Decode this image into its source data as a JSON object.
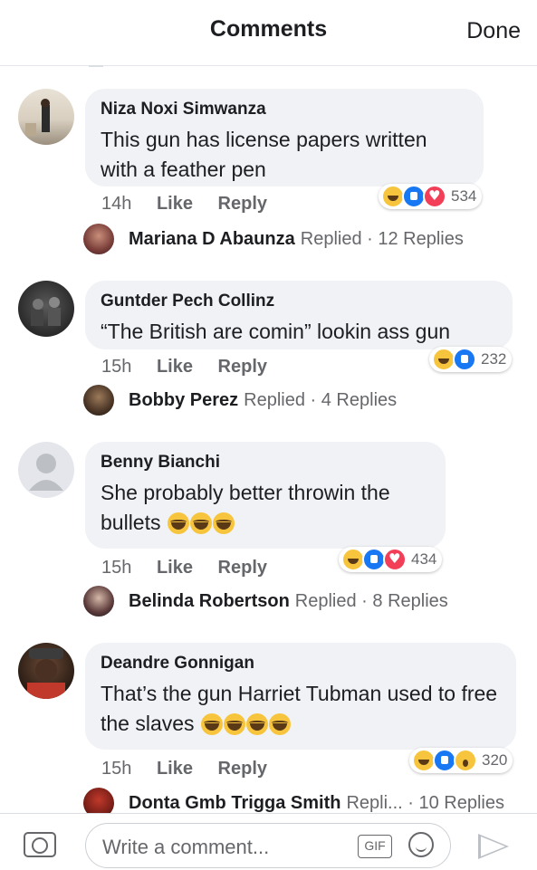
{
  "header": {
    "title": "Comments",
    "done_label": "Done"
  },
  "comments": [
    {
      "author": "Niza Noxi Simwanza",
      "text": "This gun has license papers written with a feather pen",
      "time": "14h",
      "like_label": "Like",
      "reply_label": "Reply",
      "reactions": [
        "haha",
        "like",
        "love"
      ],
      "reaction_count": "534",
      "reply_by": "Mariana D Abaunza",
      "reply_suffix": "Replied · 12 Replies"
    },
    {
      "author": "Guntder Pech Collinz",
      "text": "“The British are comin” lookin ass gun",
      "time": "15h",
      "like_label": "Like",
      "reply_label": "Reply",
      "reactions": [
        "haha",
        "like"
      ],
      "reaction_count": "232",
      "reply_by": "Bobby Perez",
      "reply_suffix": "Replied · 4 Replies"
    },
    {
      "author": "Benny Bianchi",
      "text": "She probably better throwin the bullets",
      "time": "15h",
      "like_label": "Like",
      "reply_label": "Reply",
      "reactions": [
        "haha",
        "like",
        "love"
      ],
      "reaction_count": "434",
      "reply_by": "Belinda Robertson",
      "reply_suffix": "Replied · 8 Replies"
    },
    {
      "author": "Deandre Gonnigan",
      "text": "That’s the gun Harriet Tubman used to free the slaves",
      "time": "15h",
      "like_label": "Like",
      "reply_label": "Reply",
      "reactions": [
        "haha",
        "like",
        "wow"
      ],
      "reaction_count": "320",
      "reply_by": "Donta Gmb Trigga Smith",
      "reply_suffix": "Repli... · 10 Replies"
    }
  ],
  "composer": {
    "placeholder": "Write a comment...",
    "gif_label": "GIF"
  },
  "icons": [
    "camera-icon",
    "gif-icon",
    "emoji-icon",
    "send-icon"
  ],
  "colors": {
    "bubble": "#f0f2f5",
    "like_blue": "#1877f2",
    "love_red": "#f33e58",
    "haha_yellow": "#f7c53d",
    "muted": "#65676b"
  }
}
